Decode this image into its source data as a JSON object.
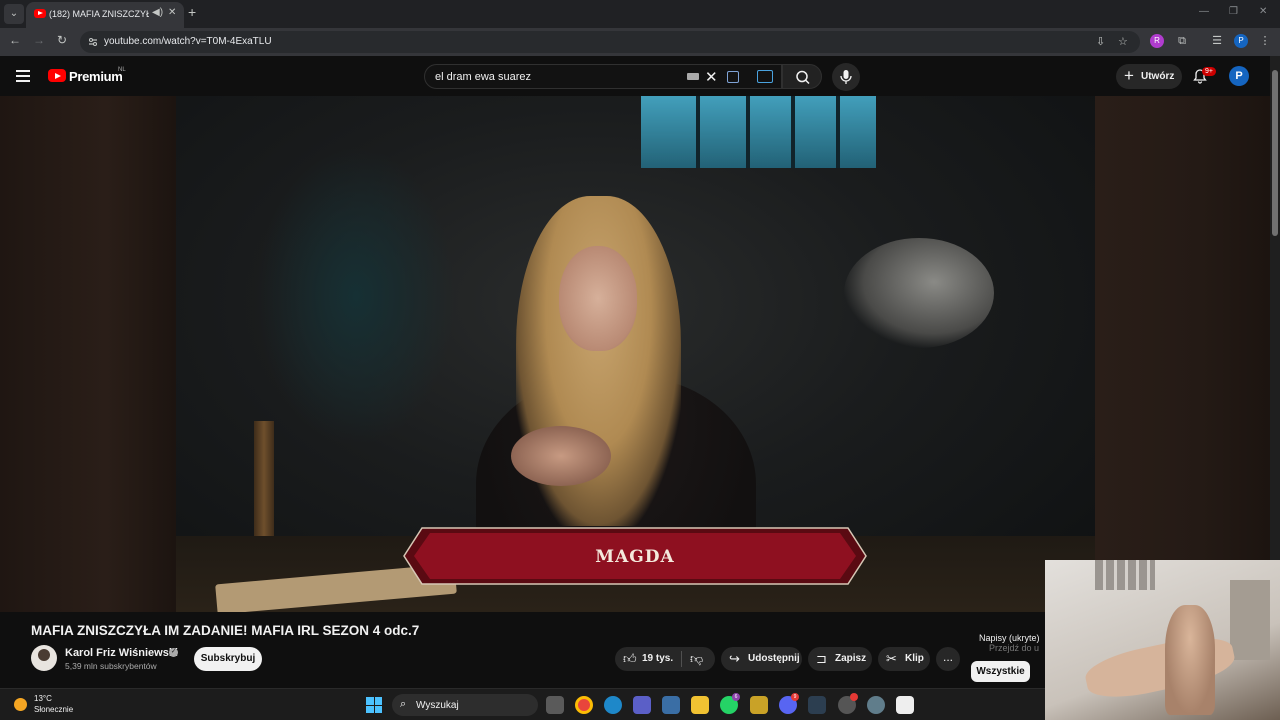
{
  "browser": {
    "tab_title": "(182) MAFIA ZNISZCZYŁA IM ZADANIE! MAFIA IRL SEZON 4 odc.7",
    "url": "youtube.com/watch?v=T0M-4ExaTLU"
  },
  "youtube": {
    "brand": "Premium",
    "country_code": "NL",
    "search_query": "el dram ewa suarez",
    "create_label": "Utwórz",
    "notification_badge": "9+",
    "account_initial": "P"
  },
  "video": {
    "name_banner": "MAGDA",
    "title": "MAFIA ZNISZCZYŁA IM ZADANIE! MAFIA IRL SEZON 4 odc.7",
    "channel_name": "Karol Friz Wiśniewski",
    "subscriber_count": "5,39 mln subskrybentów",
    "subscribe_label": "Subskrybuj",
    "like_count": "19 tys.",
    "share_label": "Udostępnij",
    "save_label": "Zapisz",
    "clip_label": "Klip",
    "more_label": "..."
  },
  "sidebar": {
    "captions_label": "Napisy (ukryte)",
    "captions_hint": "Przejdź do u",
    "filter_all": "Wszystkie"
  },
  "taskbar": {
    "temperature": "13°C",
    "weather": "Słonecznie",
    "search_label": "Wyszukaj"
  },
  "colors": {
    "youtube_red": "#ff0000",
    "background": "#0f0f0f",
    "banner_red": "#8e1020",
    "windows_accent": "#4cc2ff"
  }
}
